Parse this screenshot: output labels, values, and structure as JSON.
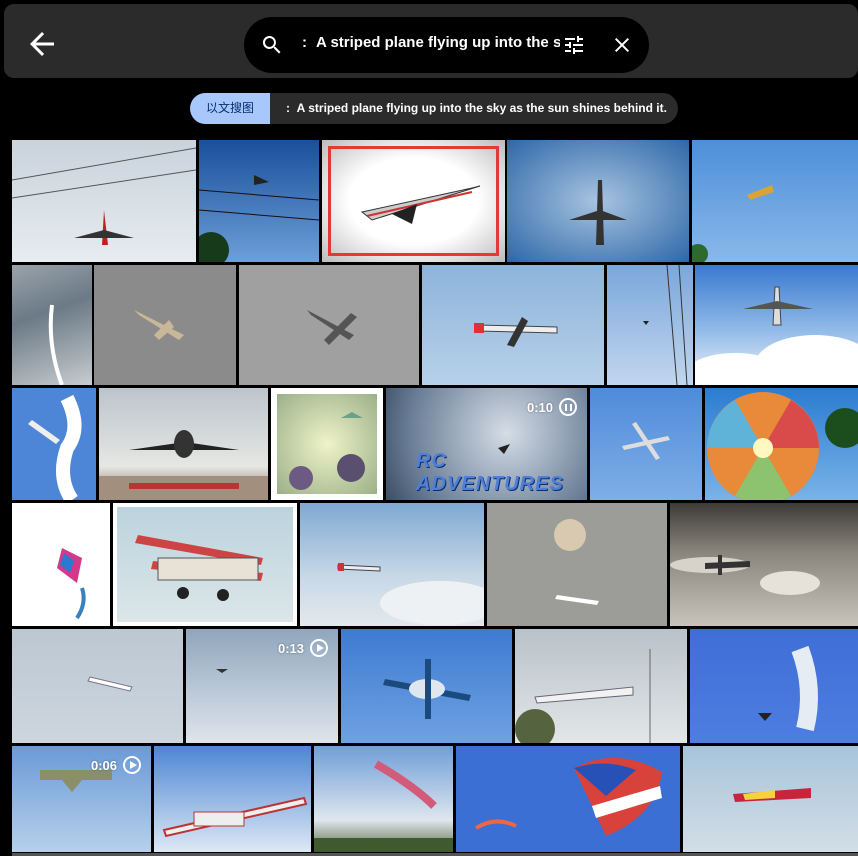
{
  "header": {
    "back_icon": "arrow-left-icon",
    "search": {
      "search_icon": "search-icon",
      "colon": ":",
      "query": "A striped plane flying up into the sky",
      "tune_icon": "tune-icon",
      "clear_icon": "close-icon"
    }
  },
  "filter_chip": {
    "label": "以文搜图",
    "colon": ":",
    "text": "A striped plane flying up into the sky as the sun shines behind it."
  },
  "results": {
    "videos": [
      {
        "duration": "0:10",
        "state": "pause-icon",
        "watermark": "RC ADVENTURES"
      },
      {
        "duration": "0:13",
        "state": "play-icon"
      },
      {
        "duration": "0:06",
        "state": "play-icon"
      }
    ]
  },
  "colors": {
    "accent_chip": "#a8c7fa",
    "selection_outline": "#e53935",
    "topbar_bg": "#2b2b2b"
  }
}
